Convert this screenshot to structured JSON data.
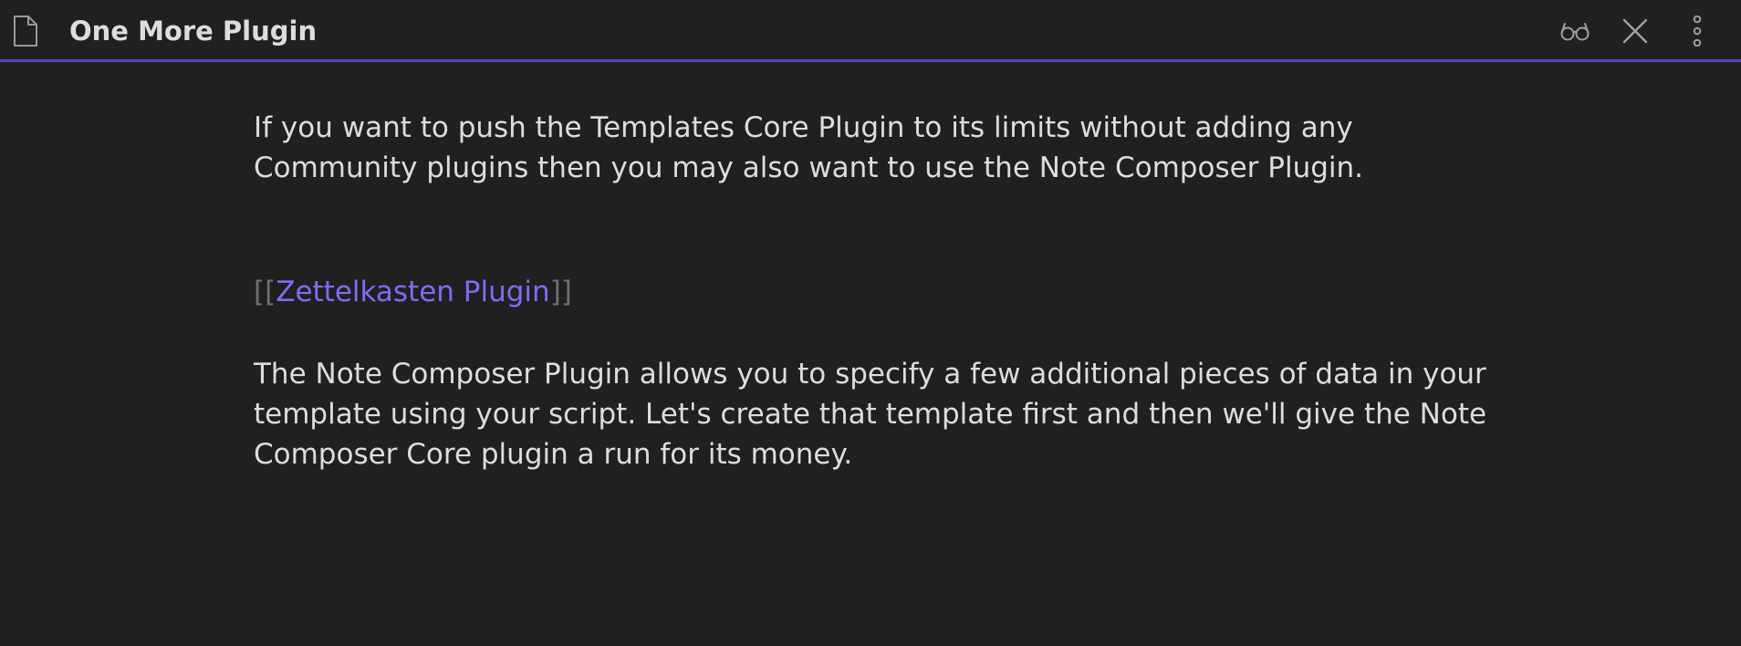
{
  "header": {
    "title": "One More Plugin",
    "icons": {
      "document": "file-icon",
      "reading_view": "glasses-icon",
      "close": "close-icon",
      "more": "more-vertical-icon"
    },
    "accent_color": "#5a47b8"
  },
  "note": {
    "paragraph_1": "If you want to push the Templates Core Plugin to its limits without adding any Community plugins then you may also want to use the Note Composer Plugin.",
    "link": {
      "open_brackets": "[[",
      "label": "Zettelkasten Plugin",
      "close_brackets": "]]",
      "color": "#7f6df2"
    },
    "paragraph_2": "The Note Composer Plugin allows you to specify a few additional pieces of data in your template using your script. Let's create that template first and then we'll give the Note Composer Core plugin a run for its money."
  }
}
